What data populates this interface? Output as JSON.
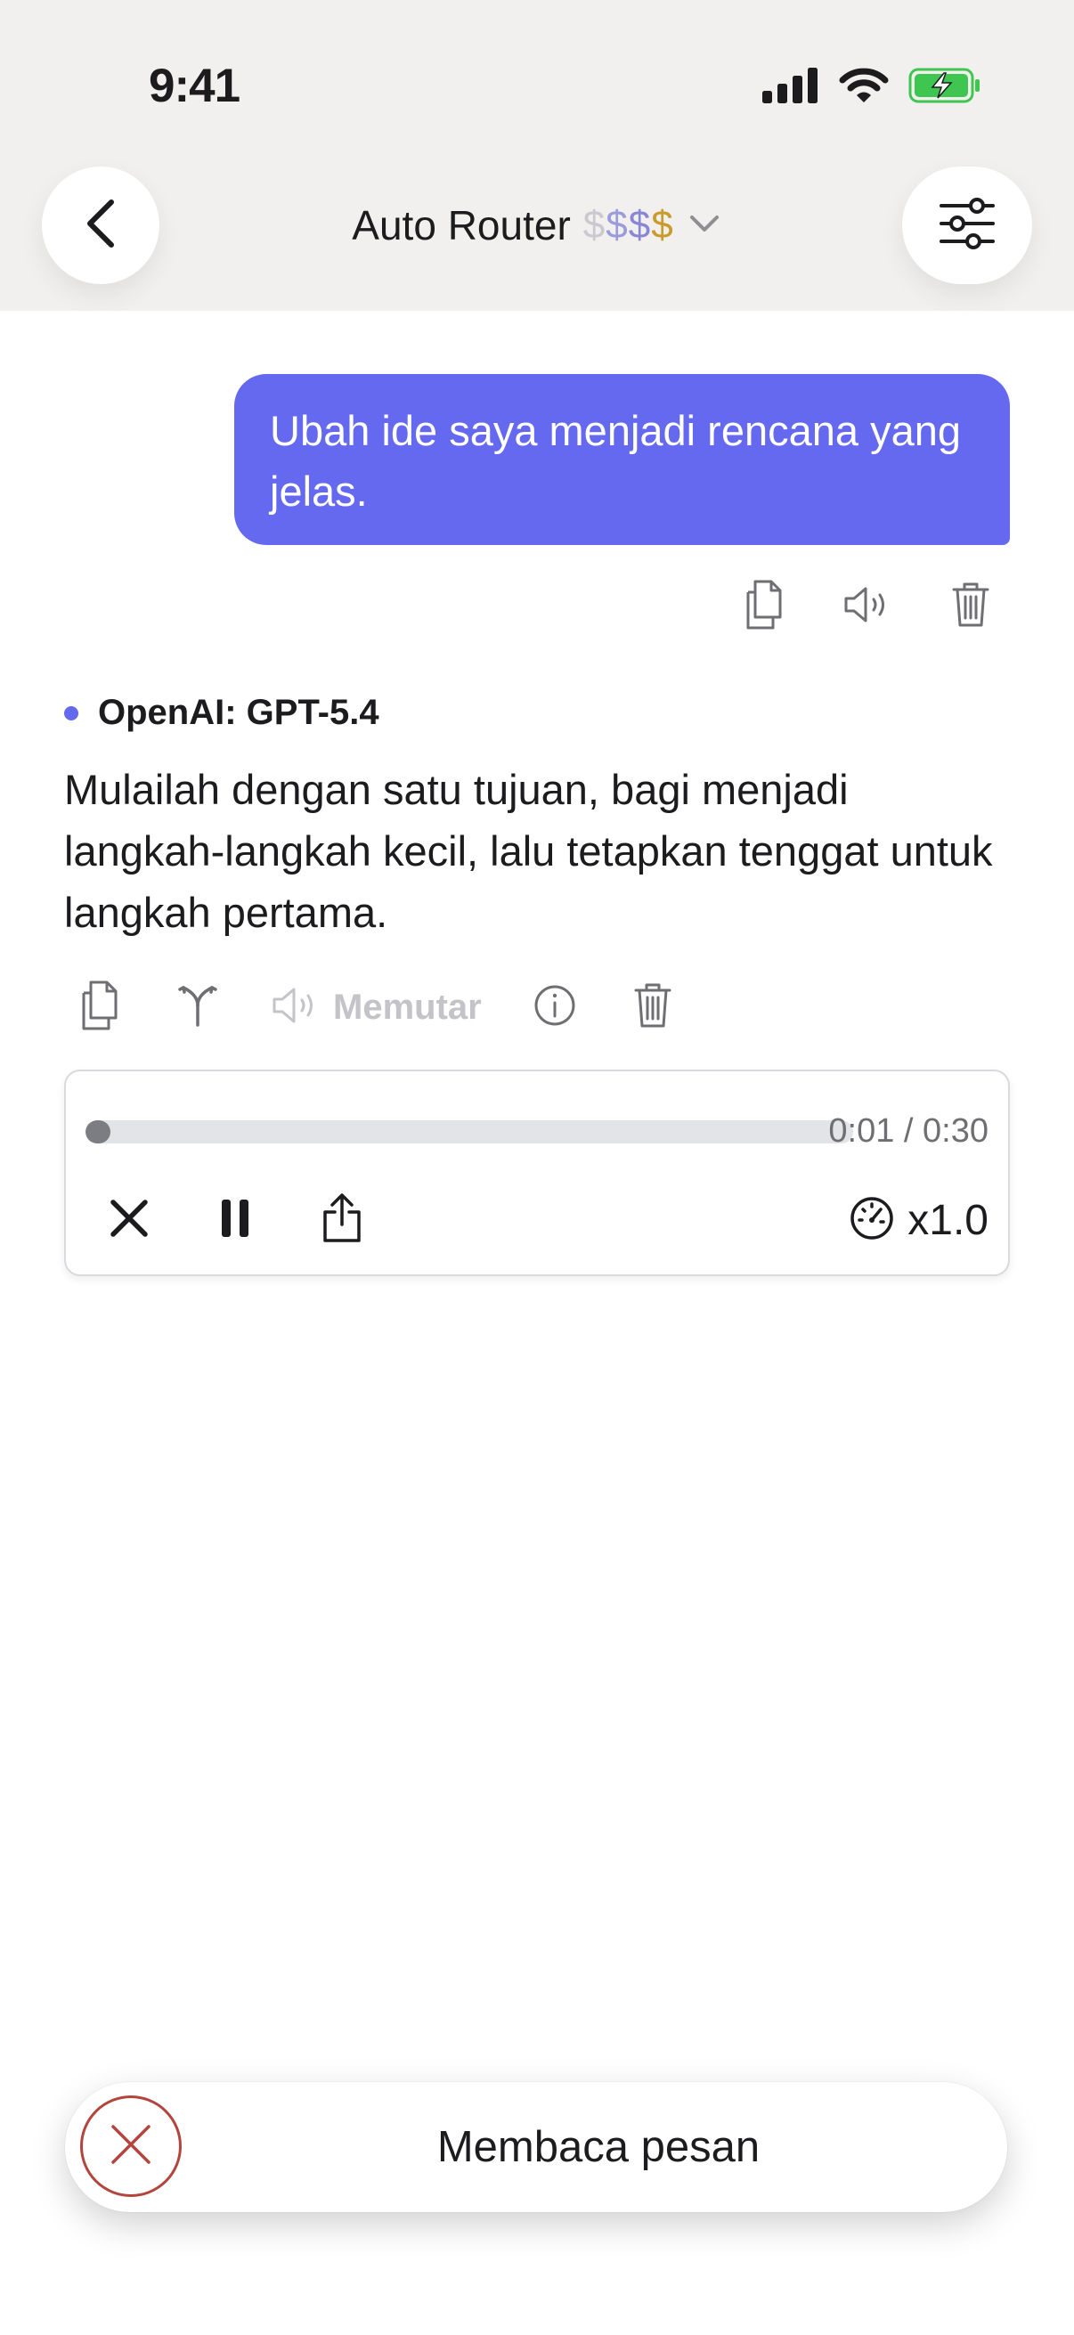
{
  "status_bar": {
    "time": "9:41"
  },
  "header": {
    "title": "Auto Router",
    "price_symbols": [
      "$",
      "$",
      "$",
      "$"
    ],
    "price_colors": [
      "#c9c9cf",
      "#9b9bdc",
      "#8a86d6",
      "#c99a2c"
    ]
  },
  "user_message": {
    "text": "Ubah ide saya menjadi rencana yang jelas."
  },
  "assistant_message": {
    "model": "OpenAI: GPT-5.4",
    "text": "Mulailah dengan satu tujuan, bagi menjadi langkah-langkah kecil, lalu tetapkan tenggat untuk langkah pertama.",
    "playing_label": "Memutar"
  },
  "player": {
    "time": "0:01 / 0:30",
    "progress_fraction": 0.033,
    "speed": "x1.0"
  },
  "toast": {
    "label": "Membaca pesan"
  },
  "colors": {
    "accent": "#6569ef",
    "header_bg": "#f1f0ee",
    "cancel_red": "#b3453d",
    "battery_green": "#3fc650"
  }
}
